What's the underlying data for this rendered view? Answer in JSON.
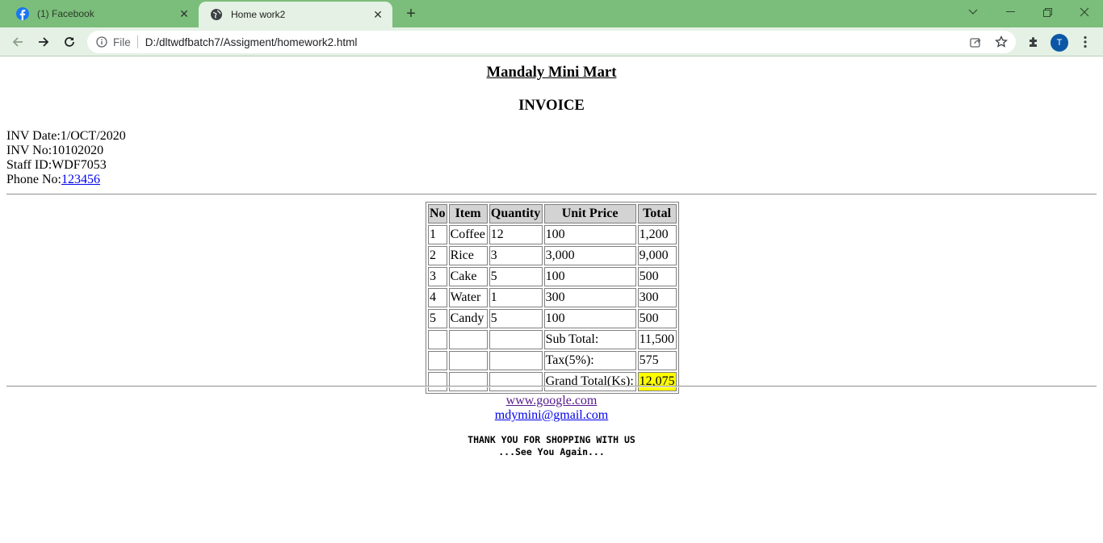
{
  "browser": {
    "tabs": [
      {
        "title": "(1) Facebook",
        "icon": "facebook-icon",
        "active": false
      },
      {
        "title": "Home work2",
        "icon": "globe-icon",
        "active": true
      }
    ],
    "address": {
      "scheme_label": "File",
      "url": "D:/dltwdfbatch7/Assigment/homework2.html"
    },
    "profile_initial": "T",
    "colors": {
      "tabbar": "#7bbd7a",
      "toolbar": "#e4f1e4",
      "avatar": "#0b57a5"
    }
  },
  "page": {
    "store_name": "Mandaly Mini Mart",
    "title": "INVOICE",
    "meta": {
      "date_label": "INV Date:",
      "date_value": "1/OCT/2020",
      "no_label": "INV No:",
      "no_value": "10102020",
      "staff_label": "Staff ID:",
      "staff_value": "WDF7053",
      "phone_label": "Phone No:",
      "phone_value": "123456"
    },
    "table": {
      "headers": [
        "No",
        "Item",
        "Quantity",
        "Unit Price",
        "Total"
      ],
      "rows": [
        {
          "no": "1",
          "item": "Coffee",
          "qty": "12",
          "price": "100",
          "total": "1,200"
        },
        {
          "no": "2",
          "item": "Rice",
          "qty": "3",
          "price": "3,000",
          "total": "9,000"
        },
        {
          "no": "3",
          "item": "Cake",
          "qty": "5",
          "price": "100",
          "total": "500"
        },
        {
          "no": "4",
          "item": "Water",
          "qty": "1",
          "price": "300",
          "total": "300"
        },
        {
          "no": "5",
          "item": "Candy",
          "qty": "5",
          "price": "100",
          "total": "500"
        }
      ],
      "summary": [
        {
          "label": "Sub Total:",
          "value": "11,500"
        },
        {
          "label": "Tax(5%):",
          "value": "575"
        },
        {
          "label": "Grand Total(Ks):",
          "value": "12,075"
        }
      ],
      "highlight_color": "#ffff00"
    },
    "footer": {
      "website": "www.google.com",
      "email": "mdymini@gmail.com",
      "thanks_line1": "THANK YOU FOR SHOPPING WITH US",
      "thanks_line2": "...See You Again..."
    }
  }
}
